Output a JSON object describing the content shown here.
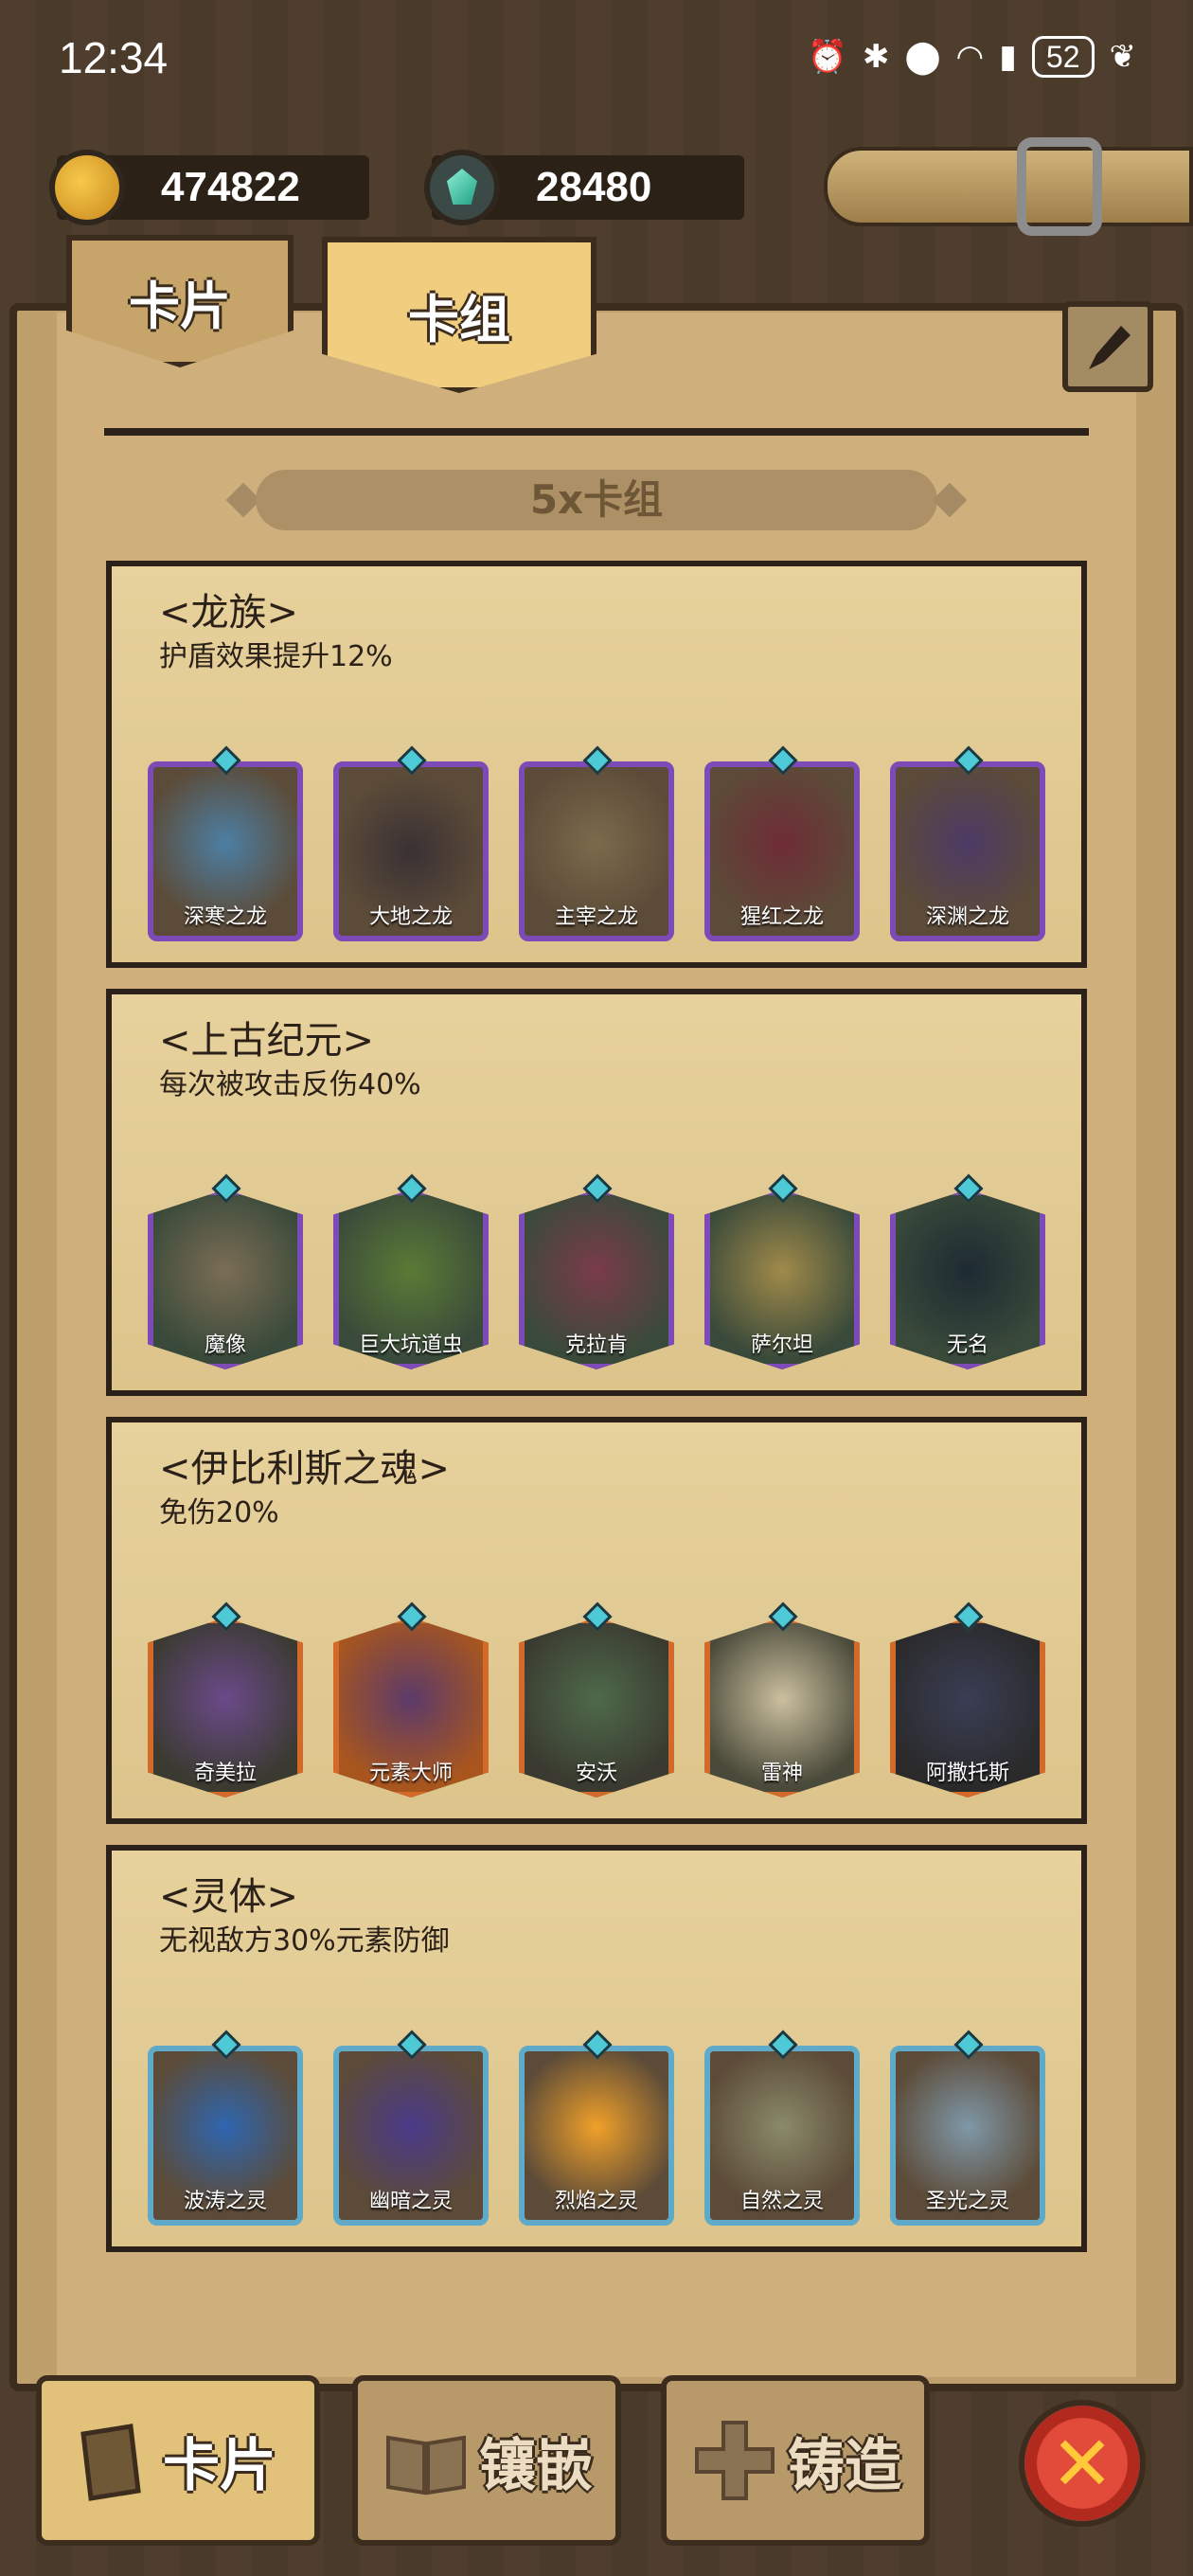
{
  "status_bar": {
    "time": "12:34",
    "battery": "52"
  },
  "currency": {
    "gold": "474822",
    "gems": "28480"
  },
  "tabs": [
    {
      "label": "卡片"
    },
    {
      "label": "卡组"
    }
  ],
  "deck_header": "5x卡组",
  "groups": [
    {
      "name": "<龙族>",
      "effect": "护盾效果提升12%",
      "frame_color": "#7d4bb8",
      "cards": [
        {
          "name": "深寒之龙"
        },
        {
          "name": "大地之龙"
        },
        {
          "name": "主宰之龙"
        },
        {
          "name": "猩红之龙"
        },
        {
          "name": "深渊之龙"
        }
      ]
    },
    {
      "name": "<上古纪元>",
      "effect": "每次被攻击反伤40%",
      "frame_color": "#7d4bb8",
      "cards": [
        {
          "name": "魔像"
        },
        {
          "name": "巨大坑道虫"
        },
        {
          "name": "克拉肯"
        },
        {
          "name": "萨尔坦"
        },
        {
          "name": "无名"
        }
      ]
    },
    {
      "name": "<伊比利斯之魂>",
      "effect": "免伤20%",
      "frame_color": "#d46a2a",
      "cards": [
        {
          "name": "奇美拉"
        },
        {
          "name": "元素大师"
        },
        {
          "name": "安沃"
        },
        {
          "name": "雷神"
        },
        {
          "name": "阿撒托斯"
        }
      ]
    },
    {
      "name": "<灵体>",
      "effect": "无视敌方30%元素防御",
      "frame_color": "#5fa9c9",
      "cards": [
        {
          "name": "波涛之灵"
        },
        {
          "name": "幽暗之灵"
        },
        {
          "name": "烈焰之灵"
        },
        {
          "name": "自然之灵"
        },
        {
          "name": "圣光之灵"
        }
      ]
    }
  ],
  "bottom_nav": [
    {
      "label": "卡片"
    },
    {
      "label": "镶嵌"
    },
    {
      "label": "铸造"
    }
  ]
}
